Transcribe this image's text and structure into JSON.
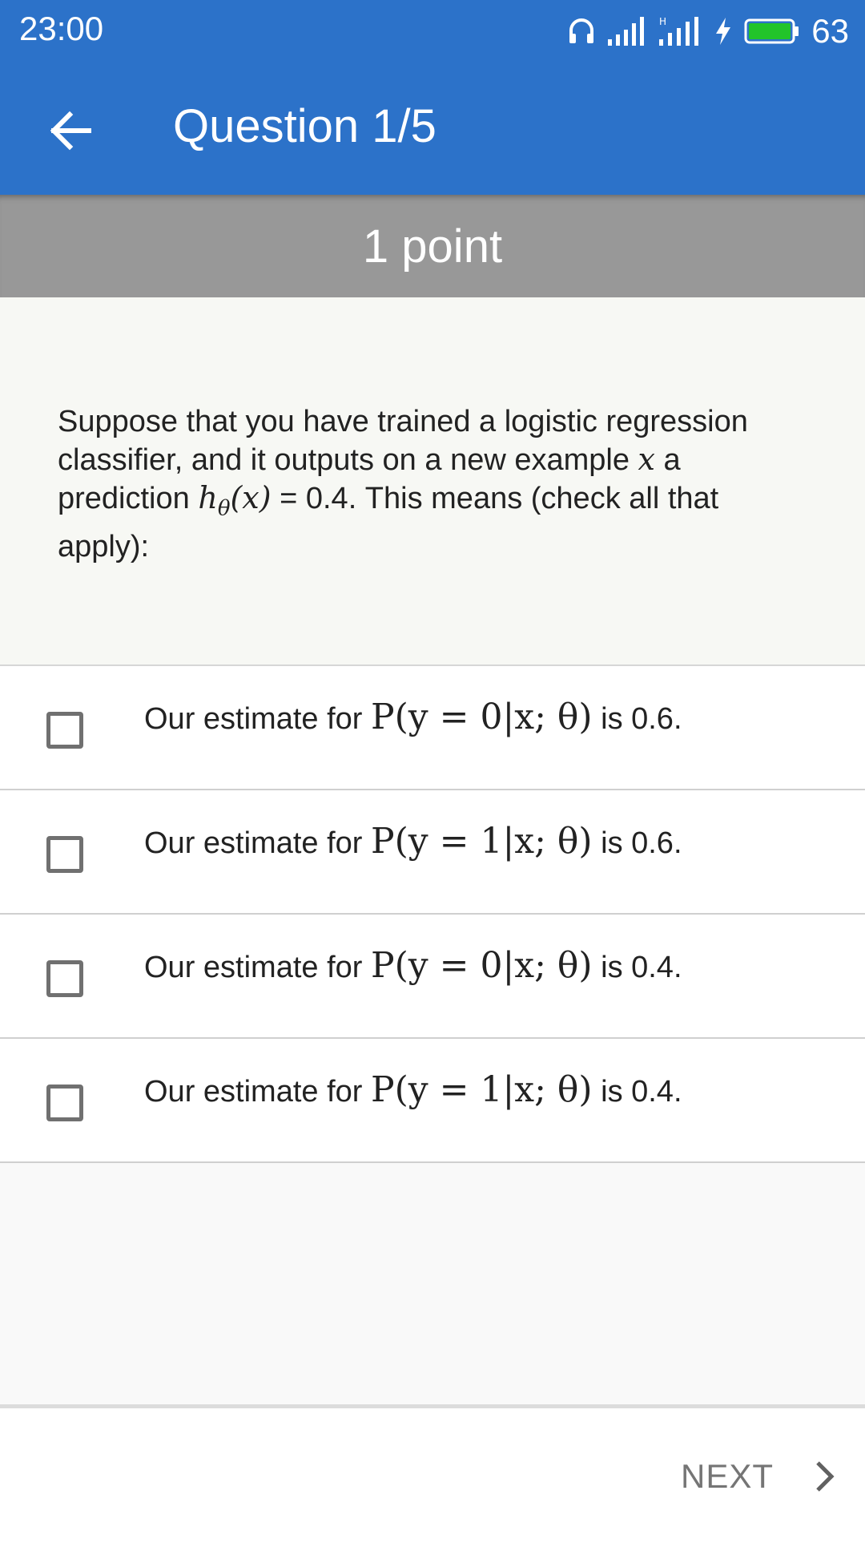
{
  "status_bar": {
    "time": "23:00",
    "battery_percent": "63",
    "icons": [
      "headset-icon",
      "signal-icon",
      "signal-h-icon",
      "charging-icon",
      "battery-icon"
    ]
  },
  "app_bar": {
    "title": "Question 1/5",
    "back_icon": "arrow-left-icon"
  },
  "points": "1 point",
  "question": {
    "text_1": "Suppose that you have trained a logistic regression classifier, and it outputs on a new example ",
    "var_x": "x",
    "text_2": " a prediction ",
    "h_theta": "h",
    "theta_sub": "θ",
    "x_arg": "(x)",
    "text_3": " = 0.4. This means (check all that apply):"
  },
  "options": [
    {
      "prefix": "Our estimate for ",
      "expr": "P(y = 0|x; θ)",
      "suffix": " is 0.6.",
      "checked": false
    },
    {
      "prefix": "Our estimate for ",
      "expr": "P(y = 1|x; θ)",
      "suffix": " is 0.6.",
      "checked": false
    },
    {
      "prefix": "Our estimate for ",
      "expr": "P(y = 0|x; θ)",
      "suffix": " is 0.4.",
      "checked": false
    },
    {
      "prefix": "Our estimate for ",
      "expr": "P(y = 1|x; θ)",
      "suffix": " is 0.4.",
      "checked": false
    }
  ],
  "footer": {
    "next_label": "NEXT",
    "next_icon": "chevron-right-icon"
  },
  "colors": {
    "primary": "#2c72c9",
    "points_bar": "#989898",
    "checkbox": "#707070",
    "next_text": "#757575"
  }
}
